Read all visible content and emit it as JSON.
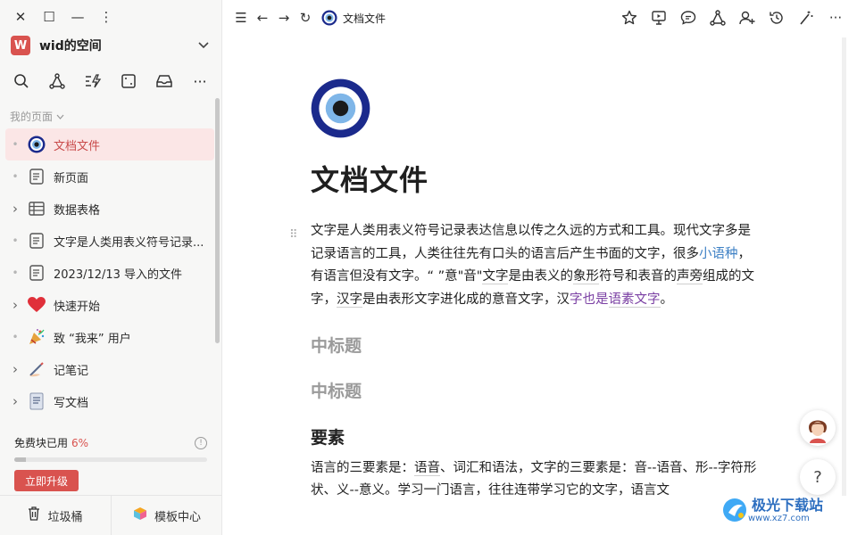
{
  "workspace": {
    "initial": "W",
    "name": "wid的空间"
  },
  "sidebar": {
    "section_label": "我的页面",
    "items": [
      {
        "label": "文档文件",
        "icon": "evil-eye-icon",
        "marker": "•",
        "active": true
      },
      {
        "label": "新页面",
        "icon": "document-icon",
        "marker": "•"
      },
      {
        "label": "数据表格",
        "icon": "table-icon",
        "marker": "›"
      },
      {
        "label": "文字是人类用表义符号记录...",
        "icon": "document-icon",
        "marker": "•"
      },
      {
        "label": "2023/12/13 导入的文件",
        "icon": "document-icon",
        "marker": "•"
      },
      {
        "label": "快速开始",
        "icon": "heart-icon",
        "marker": "›"
      },
      {
        "label": "致 “我来” 用户",
        "icon": "party-popper-icon",
        "marker": "•"
      },
      {
        "label": "记笔记",
        "icon": "writing-hand-icon",
        "marker": "›"
      },
      {
        "label": "写文档",
        "icon": "page-icon",
        "marker": "›"
      }
    ],
    "quota": {
      "label": "免费块已用",
      "percent_text": "6%",
      "percent": 0.06
    },
    "upgrade_label": "立即升级",
    "footer": {
      "trash_label": "垃圾桶",
      "templates_label": "模板中心"
    }
  },
  "topbar": {
    "breadcrumb": "文档文件"
  },
  "document": {
    "title": "文档文件",
    "para1": {
      "t1": "文字是人类用表义符号记录表达信息以传之久远的方式和工具。现代文字多是记录语言的工具，人类往往先有口头的语言后产生书面的文字，很多",
      "link1": "小语种",
      "t2": "，有语言但没有文字。“ ”意\"音\"",
      "link2": "文字",
      "t3": "是由表义的",
      "link3": "象形",
      "t4": "符号和表音的",
      "link4": "声旁",
      "t5": "组成的文字，",
      "link5": "汉字",
      "t6": "是由表形文字进化成的意音文字，汉",
      "link6": "字也是",
      "link7": "语素文字",
      "t7": "。"
    },
    "heading1": "中标题",
    "heading2": "中标题",
    "heading3": "要素",
    "para2": {
      "t1": "语言的三要素是：",
      "link1": "语音",
      "t2": "、词汇和语法，文字的三要素是：音--语音、形--字符形状、义--意义。学习一门语言，往往连带学习它的文字，语言文"
    }
  },
  "watermark": {
    "text": "极光下载站",
    "sub": "www.xz7.com"
  }
}
